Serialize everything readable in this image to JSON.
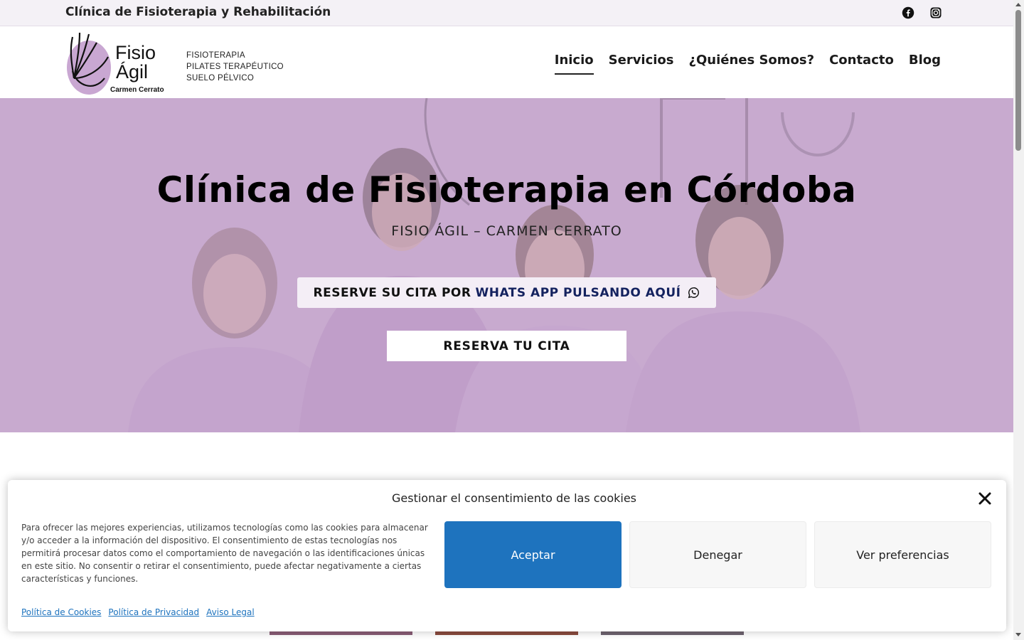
{
  "topbar": {
    "title": "Clínica de Fisioterapia y Rehabilitación",
    "social_icons": [
      "facebook-icon",
      "instagram-icon"
    ]
  },
  "header": {
    "logo": {
      "line1": "Fisio",
      "line2": "Ágil",
      "line3": "Carmen Cerrato"
    },
    "taglines": [
      "FISIOTERAPIA",
      "PILATES TERAPÉUTICO",
      "SUELO PÉLVICO"
    ],
    "nav": [
      {
        "label": "Inicio",
        "active": true
      },
      {
        "label": "Servicios",
        "active": false
      },
      {
        "label": "¿Quiénes Somos?",
        "active": false
      },
      {
        "label": "Contacto",
        "active": false
      },
      {
        "label": "Blog",
        "active": false
      }
    ]
  },
  "hero": {
    "title": "Clínica de Fisioterapia en Córdoba",
    "subtitle": "FISIO ÁGIL – CARMEN CERRATO",
    "whatsapp_button": {
      "label_main": "RESERVE SU CITA POR",
      "label_highlight": "WHATS APP PULSANDO AQUÍ",
      "icon": "whatsapp-icon"
    },
    "cita_button": "RESERVA TU CITA",
    "accent_color": "#c4a6cb"
  },
  "cookies": {
    "title": "Gestionar el consentimiento de las cookies",
    "text": "Para ofrecer las mejores experiencias, utilizamos tecnologías como las cookies para almacenar y/o acceder a la información del dispositivo. El consentimiento de estas tecnologías nos permitirá procesar datos como el comportamiento de navegación o las identificaciones únicas en este sitio. No consentir o retirar el consentimiento, puede afectar negativamente a ciertas características y funciones.",
    "accept": "Aceptar",
    "deny": "Denegar",
    "preferences": "Ver preferencias",
    "links": [
      "Política de Cookies",
      "Política de Privacidad",
      "Aviso Legal"
    ],
    "accept_color": "#1e73be"
  }
}
